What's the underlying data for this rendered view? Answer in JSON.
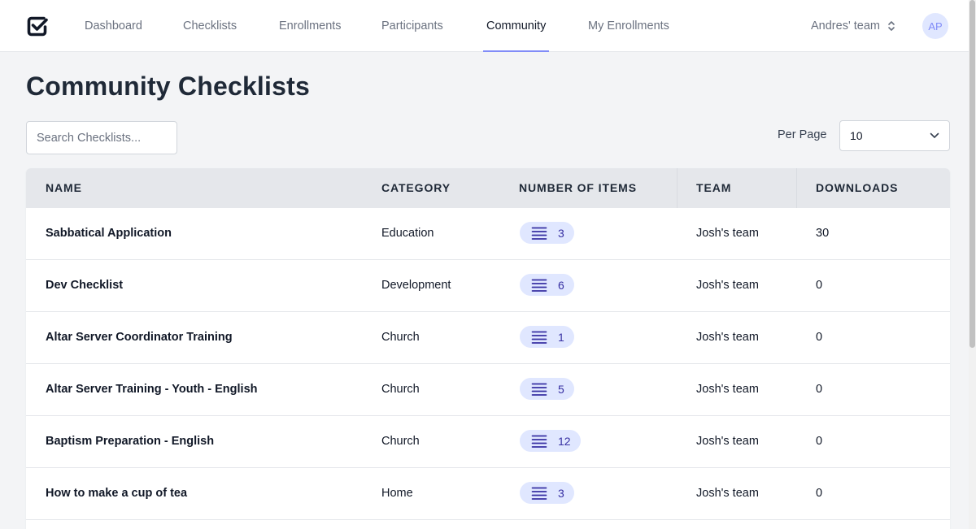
{
  "nav": {
    "items": [
      {
        "label": "Dashboard",
        "active": false
      },
      {
        "label": "Checklists",
        "active": false
      },
      {
        "label": "Enrollments",
        "active": false
      },
      {
        "label": "Participants",
        "active": false
      },
      {
        "label": "Community",
        "active": true
      },
      {
        "label": "My Enrollments",
        "active": false
      }
    ],
    "team": "Andres' team",
    "avatar_initials": "AP"
  },
  "page": {
    "title": "Community Checklists",
    "search_placeholder": "Search Checklists...",
    "per_page_label": "Per Page",
    "per_page_value": "10"
  },
  "table": {
    "headers": [
      "Name",
      "Category",
      "Number of Items",
      "Team",
      "Downloads"
    ],
    "rows": [
      {
        "name": "Sabbatical Application",
        "category": "Education",
        "items": "3",
        "team": "Josh's team",
        "downloads": "30"
      },
      {
        "name": "Dev Checklist",
        "category": "Development",
        "items": "6",
        "team": "Josh's team",
        "downloads": "0"
      },
      {
        "name": "Altar Server Coordinator Training",
        "category": "Church",
        "items": "1",
        "team": "Josh's team",
        "downloads": "0"
      },
      {
        "name": "Altar Server Training - Youth - English",
        "category": "Church",
        "items": "5",
        "team": "Josh's team",
        "downloads": "0"
      },
      {
        "name": "Baptism Preparation - English",
        "category": "Church",
        "items": "12",
        "team": "Josh's team",
        "downloads": "0"
      },
      {
        "name": "How to make a cup of tea",
        "category": "Home",
        "items": "3",
        "team": "Josh's team",
        "downloads": "0"
      }
    ]
  },
  "colors": {
    "accent": "#818cf8",
    "badge_bg": "#e0e7ff",
    "badge_text": "#3730a3",
    "header_bg": "#e5e7eb"
  },
  "icons": {
    "logo": "checkbox-logo-icon",
    "team_switch": "chevron-up-down-icon",
    "select": "chevron-down-icon",
    "items": "list-icon"
  }
}
